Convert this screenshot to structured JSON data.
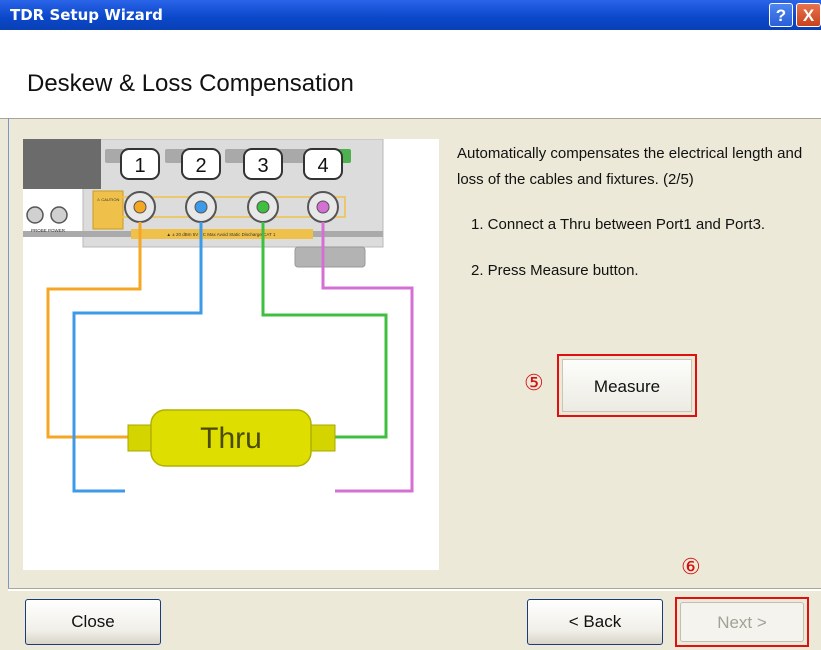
{
  "window": {
    "title": "TDR Setup Wizard",
    "help_glyph": "?",
    "close_glyph": "X"
  },
  "page": {
    "heading": "Deskew & Loss Compensation"
  },
  "diagram": {
    "ports": [
      "1",
      "2",
      "3",
      "4"
    ],
    "thru_label": "Thru",
    "caution_text": "⚠ CAUTION",
    "warning_text": "▲ ± 20 dBm 5V DC Max  Avoid Static Discharge CAT 1",
    "probe_power_label": "PROBE POWER",
    "cable_colors": {
      "port1": "#f5a623",
      "port2": "#3c9ae8",
      "port3": "#3fbf3f",
      "port4": "#d470d4"
    }
  },
  "instructions": {
    "description": "Automatically compensates the electrical length and loss of the cables and fixtures.  (2/5)",
    "steps": [
      "1. Connect a Thru between Port1 and Port3.",
      "2. Press Measure button."
    ]
  },
  "annotations": {
    "measure_marker": "⑤",
    "next_marker": "⑥",
    "color": "#d41010"
  },
  "buttons": {
    "measure": "Measure",
    "close": "Close",
    "back": "< Back",
    "next": "Next >"
  }
}
